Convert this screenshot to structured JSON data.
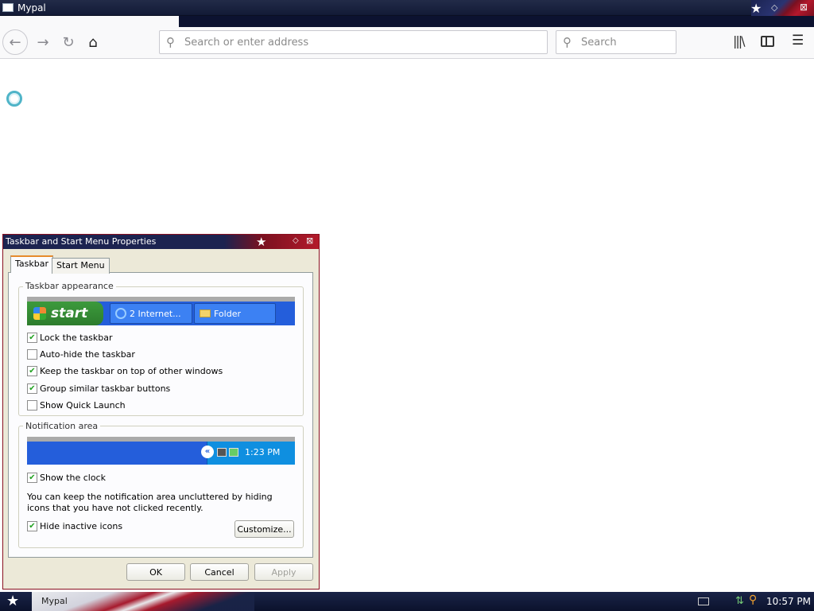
{
  "window": {
    "title": "Mypal"
  },
  "toolbar": {
    "url_placeholder": "Search or enter address",
    "search_placeholder": "Search"
  },
  "dialog": {
    "title": "Taskbar and Start Menu Properties",
    "tabs": [
      "Taskbar",
      "Start Menu"
    ],
    "appearance": {
      "legend": "Taskbar appearance",
      "preview": {
        "start_label": "start",
        "item1": "2 Internet...",
        "item2": "Folder"
      },
      "options": [
        {
          "label": "Lock the taskbar",
          "checked": true
        },
        {
          "label": "Auto-hide the taskbar",
          "checked": false
        },
        {
          "label": "Keep the taskbar on top of other windows",
          "checked": true
        },
        {
          "label": "Group similar taskbar buttons",
          "checked": true
        },
        {
          "label": "Show Quick Launch",
          "checked": false
        }
      ]
    },
    "notification": {
      "legend": "Notification area",
      "preview_time": "1:23 PM",
      "show_clock": {
        "label": "Show the clock",
        "checked": true
      },
      "description": "You can keep the notification area uncluttered by hiding icons that you have not clicked recently.",
      "hide_inactive": {
        "label": "Hide inactive icons",
        "checked": true
      },
      "customize_label": "Customize..."
    },
    "buttons": {
      "ok": "OK",
      "cancel": "Cancel",
      "apply": "Apply"
    }
  },
  "taskbar": {
    "task_label": "Mypal",
    "clock": "10:57 PM"
  },
  "colors": {
    "accent_red": "#b31a2a",
    "navy": "#1c2350",
    "xp_blue": "#245edb"
  }
}
